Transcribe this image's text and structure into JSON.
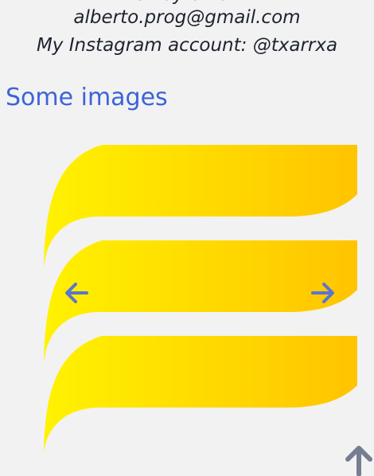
{
  "contact": {
    "partial_line": "Or by email",
    "email": "alberto.prog@gmail.com",
    "instagram": "My Instagram account: @txarrxa"
  },
  "section": {
    "title": "Some images"
  },
  "carousel": {
    "image_name": "yellow stacked stripes",
    "colors": {
      "start": "#fff200",
      "end": "#ffc400",
      "arrow": "#5c75d1"
    }
  },
  "icons": {
    "previous": "arrow-left-icon",
    "next": "arrow-right-icon",
    "scroll_top": "arrow-up-icon"
  }
}
